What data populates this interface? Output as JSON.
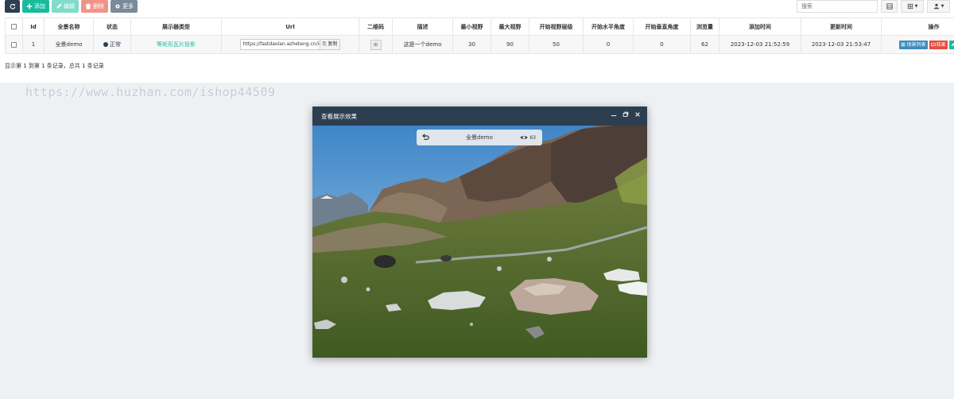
{
  "toolbar": {
    "refresh_icon": "refresh-icon",
    "add_label": "添加",
    "edit_label": "编辑",
    "delete_label": "删除",
    "more_label": "更多",
    "colors": {
      "refresh": "#2c3e50",
      "add": "#18bc9c",
      "edit": "#7fddc9",
      "delete": "#f0938b",
      "more": "#7b8a99"
    }
  },
  "search": {
    "placeholder": "搜索"
  },
  "table": {
    "columns": [
      "Id",
      "全景名称",
      "状态",
      "展示器类型",
      "Url",
      "二维码",
      "描述",
      "最小视野",
      "最大视野",
      "开始视野层级",
      "开始水平角度",
      "开始垂直角度",
      "浏览量",
      "添加时间",
      "更新时间",
      "操作"
    ],
    "rows": [
      {
        "id": "1",
        "name": "全景demo",
        "status": "正常",
        "type": "等矩形瓦片投影",
        "url": "https://fastdaolan.azheteng.cn/index",
        "copy_label": "复制",
        "qr_label": "⊞",
        "desc": "这是一个demo",
        "min_fov": "30",
        "max_fov": "90",
        "start_level": "50",
        "start_h": "0",
        "start_v": "0",
        "views": "62",
        "created": "2023-12-03 21:52:59",
        "updated": "2023-12-03 21:53:47",
        "op_scene": "场景列表",
        "op_effect": "效果"
      }
    ]
  },
  "pager_text": "显示第 1 到第 1 条记录，总共 1 条记录",
  "watermark": "https://www.huzhan.com/ishop44509",
  "modal": {
    "title": "查看展示效果",
    "pano_title": "全景demo",
    "pano_views": "63"
  },
  "accent_colors": {
    "primary": "#2c3e50",
    "success": "#18bc9c",
    "danger": "#e74c3c",
    "info": "#3c8dbc"
  }
}
